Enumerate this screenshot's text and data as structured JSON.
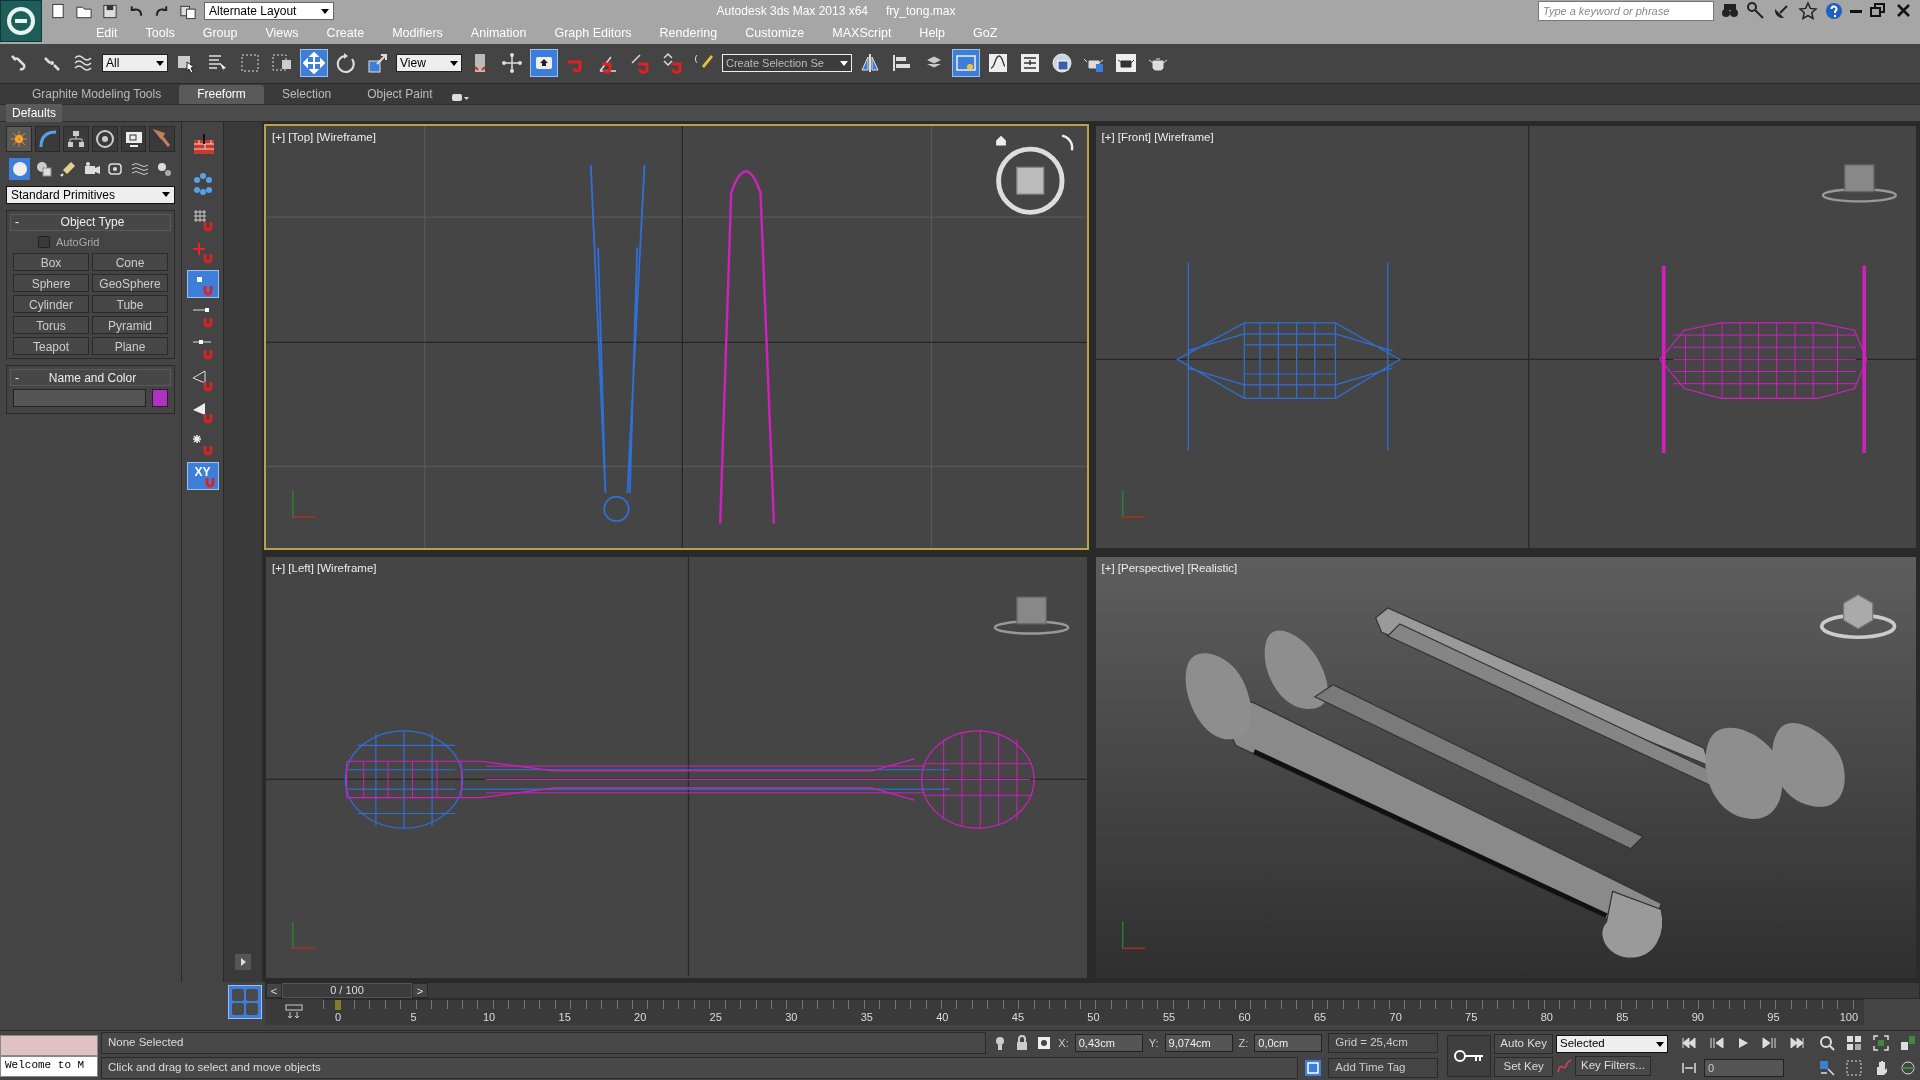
{
  "title_bar": {
    "layout": "Alternate Layout",
    "app_title": "Autodesk 3ds Max  2013 x64",
    "file_name": "fry_tong.max",
    "search": {
      "placeholder": "Type a keyword or phrase"
    }
  },
  "menu": [
    "Edit",
    "Tools",
    "Group",
    "Views",
    "Create",
    "Modifiers",
    "Animation",
    "Graph Editors",
    "Rendering",
    "Customize",
    "MAXScript",
    "Help",
    "GoZ"
  ],
  "main_toolbar": [
    {
      "kind": "icon",
      "selected": false
    },
    {
      "kind": "icon",
      "selected": false
    },
    {
      "kind": "icon",
      "selected": false
    },
    {
      "kind": "dropdown",
      "value": "All"
    },
    {
      "kind": "icon",
      "selected": false
    },
    {
      "kind": "icon",
      "selected": false
    },
    {
      "kind": "icon",
      "selected": false
    },
    {
      "kind": "icon",
      "selected": false
    },
    {
      "kind": "icon",
      "selected": true
    },
    {
      "kind": "icon",
      "selected": false
    },
    {
      "kind": "icon",
      "selected": false
    },
    {
      "kind": "dropdown",
      "value": "View"
    },
    {
      "kind": "icon",
      "selected": false
    },
    {
      "kind": "icon",
      "selected": false
    },
    {
      "kind": "icon",
      "selected": true
    },
    {
      "kind": "icon",
      "selected": false
    },
    {
      "kind": "icon",
      "selected": false
    },
    {
      "kind": "icon",
      "selected": false
    },
    {
      "kind": "icon",
      "selected": false
    },
    {
      "kind": "icon",
      "selected": false
    },
    {
      "kind": "dropdown",
      "value": "Create Selection Se"
    },
    {
      "kind": "icon",
      "selected": false
    },
    {
      "kind": "icon",
      "selected": false
    },
    {
      "kind": "icon",
      "selected": false
    },
    {
      "kind": "icon",
      "selected": true
    },
    {
      "kind": "icon",
      "selected": false
    },
    {
      "kind": "icon",
      "selected": false
    },
    {
      "kind": "icon",
      "selected": false
    },
    {
      "kind": "icon",
      "selected": false
    },
    {
      "kind": "icon",
      "selected": false
    },
    {
      "kind": "icon",
      "selected": false
    }
  ],
  "ribbon": {
    "tabs": [
      {
        "label": "Graphite Modeling Tools",
        "selected": false
      },
      {
        "label": "Freeform",
        "selected": true
      },
      {
        "label": "Selection",
        "selected": false
      },
      {
        "label": "Object Paint",
        "selected": false
      }
    ],
    "panel": "Defaults"
  },
  "command_panel": {
    "tabs": [
      {
        "selected": true
      },
      {
        "selected": false
      },
      {
        "selected": false
      },
      {
        "selected": false
      },
      {
        "selected": false
      },
      {
        "selected": false
      }
    ],
    "categories": [
      {
        "selected": true
      },
      {
        "selected": false
      },
      {
        "selected": false
      },
      {
        "selected": false
      },
      {
        "selected": false
      },
      {
        "selected": false
      },
      {
        "selected": false
      }
    ],
    "dropdown": "Standard Primitives",
    "object_type": {
      "toggle": "-",
      "title": "Object Type",
      "autogrid": {
        "label": "AutoGrid",
        "checked": false
      },
      "buttons": [
        "Box",
        "Cone",
        "Sphere",
        "GeoSphere",
        "Cylinder",
        "Tube",
        "Torus",
        "Pyramid",
        "Teapot",
        "Plane"
      ]
    },
    "name_and_color": {
      "toggle": "-",
      "title": "Name and Color",
      "color": "#b030c0"
    }
  },
  "snap_toolbar": [
    {
      "selected": false
    },
    {
      "selected": false
    },
    {
      "selected": false
    },
    {
      "selected": false
    },
    {
      "selected": true
    },
    {
      "selected": false
    },
    {
      "selected": false
    },
    {
      "selected": false
    },
    {
      "selected": false
    },
    {
      "selected": false
    },
    {
      "selected": true,
      "label": "XY"
    }
  ],
  "viewports": [
    {
      "label": "[+] [Top] [Wireframe]",
      "kind": "top",
      "selected": true
    },
    {
      "label": "[+] [Front] [Wireframe]",
      "kind": "front",
      "selected": false
    },
    {
      "label": "[+] [Left] [Wireframe]",
      "kind": "left",
      "selected": false
    },
    {
      "label": "[+] [Perspective] [Realistic]",
      "kind": "perspective",
      "selected": false
    }
  ],
  "time_slider": {
    "prev": "<",
    "reading": "0 / 100",
    "next": ">"
  },
  "ruler": [
    "0",
    "5",
    "10",
    "15",
    "20",
    "25",
    "30",
    "35",
    "40",
    "45",
    "50",
    "55",
    "60",
    "65",
    "70",
    "75",
    "80",
    "85",
    "90",
    "95",
    "100"
  ],
  "status": {
    "listener": "Welcome to M",
    "selection": "None Selected",
    "prompt": "Click and drag to select and move objects",
    "coords": [
      {
        "label": "X:",
        "value": "0,43cm"
      },
      {
        "label": "Y:",
        "value": "9,074cm"
      },
      {
        "label": "Z:",
        "value": "0,0cm"
      }
    ],
    "grid": "Grid = 25,4cm",
    "add_time_tag": "Add Time Tag"
  },
  "animation": {
    "auto_key": "Auto Key",
    "set_key": "Set Key",
    "key_mode": "Selected",
    "key_filters": "Key Filters...",
    "frame": "0"
  }
}
